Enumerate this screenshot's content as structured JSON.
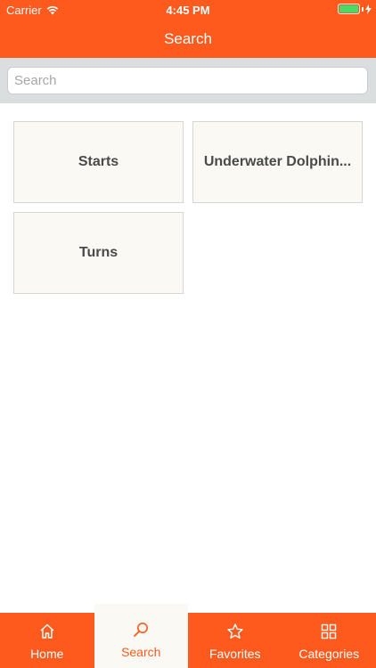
{
  "status_bar": {
    "carrier": "Carrier",
    "time": "4:45 PM"
  },
  "nav": {
    "title": "Search"
  },
  "search": {
    "placeholder": "Search",
    "value": ""
  },
  "tiles": [
    {
      "label": "Starts"
    },
    {
      "label": "Underwater Dolphin..."
    },
    {
      "label": "Turns"
    }
  ],
  "tabbar": {
    "items": [
      {
        "label": "Home",
        "icon": "home-icon"
      },
      {
        "label": "Search",
        "icon": "search-icon",
        "active": true
      },
      {
        "label": "Favorites",
        "icon": "star-icon"
      },
      {
        "label": "Categories",
        "icon": "grid-icon"
      }
    ]
  },
  "colors": {
    "accent": "#fe5a1d",
    "tile_bg": "#faf9f4",
    "search_bg": "#dadedf",
    "battery": "#4cd964"
  }
}
